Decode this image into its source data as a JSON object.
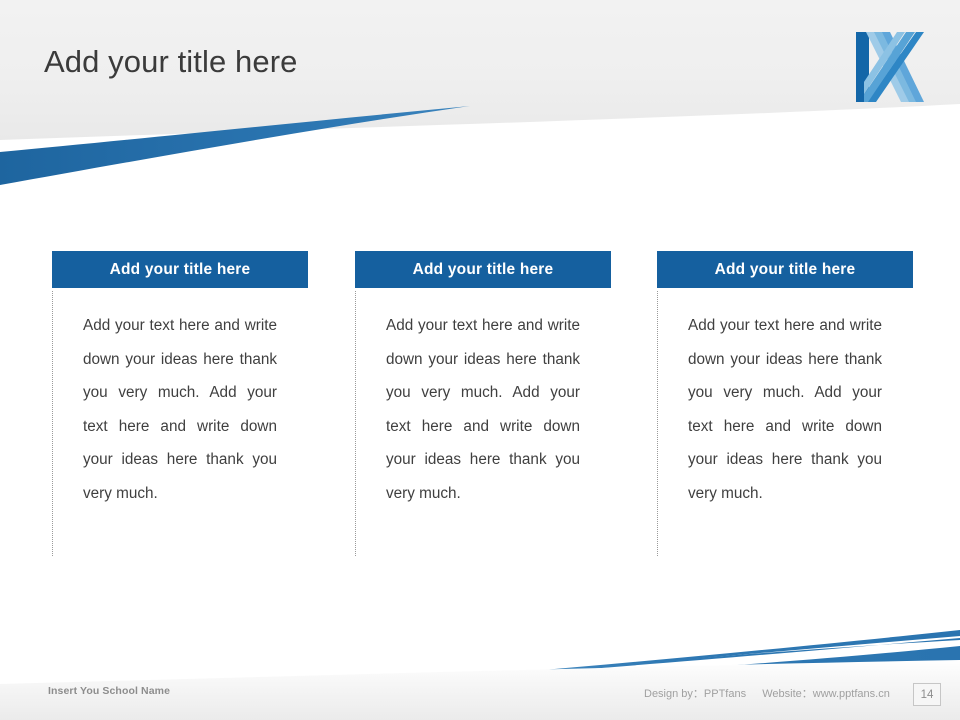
{
  "slide": {
    "title": "Add your title here",
    "logo_name": "stylized-k-logo",
    "accent_color": "#15609f",
    "accent_color_light": "#5fa6da",
    "title_color": "#3b3b3b"
  },
  "columns": [
    {
      "header": "Add your title here",
      "body": "Add your text here and write down your ideas here thank you very much. Add your text here and write down your ideas here thank you very much."
    },
    {
      "header": "Add your title here",
      "body": "Add your text here and write down your ideas here thank you very much. Add your text here and write down your ideas here thank you very much."
    },
    {
      "header": "Add your title here",
      "body": "Add your text here and write down your ideas here thank you very much. Add your text here and write down your ideas here thank you very much."
    }
  ],
  "footer": {
    "school_name": "Insert You School Name",
    "design_by_label": "Design by：PPTfans",
    "website_label": "Website：www.pptfans.cn",
    "page_number": "14"
  }
}
